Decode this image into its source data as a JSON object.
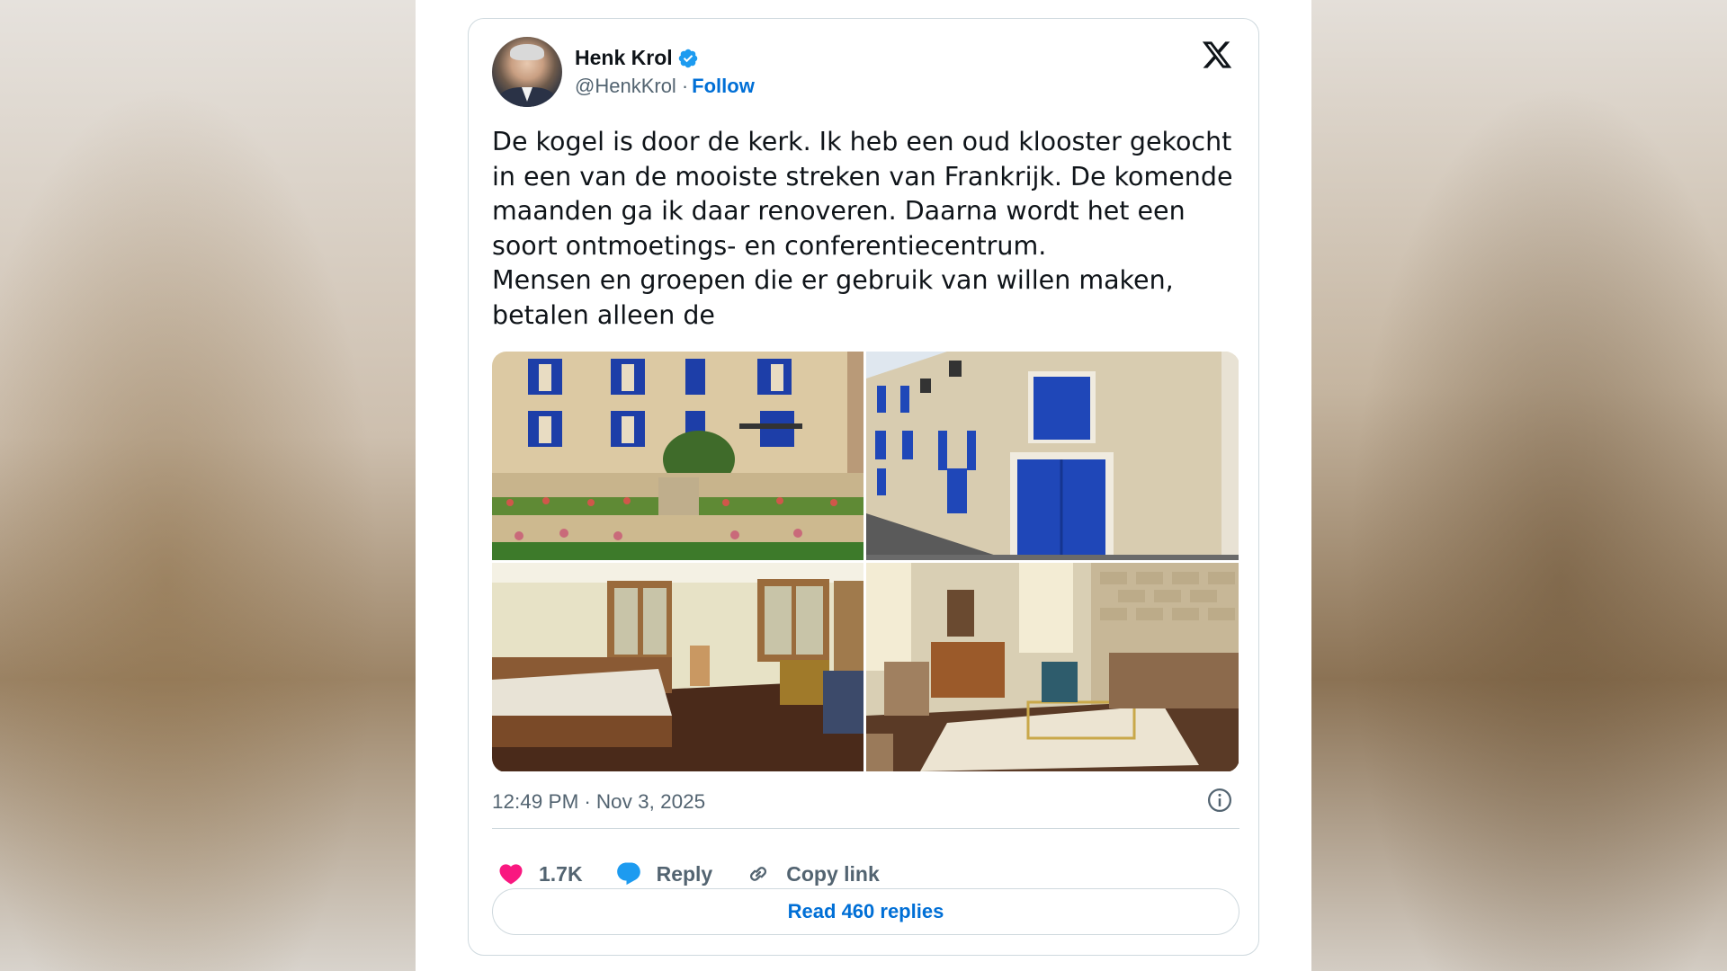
{
  "tweet": {
    "author_name": "Henk Krol",
    "handle": "@HenkKrol",
    "separator": "·",
    "follow_label": "Follow",
    "text": "De kogel is door de kerk. Ik heb een oud klooster gekocht in een van de mooiste streken van Frankrijk. De komende maanden ga ik daar renoveren. Daarna wordt het een soort ontmoetings- en conferentiecentrum.\nMensen en groepen die er gebruik van willen maken, betalen alleen de",
    "time": "12:49 PM",
    "date": "Nov 3, 2025",
    "likes": "1.7K",
    "reply_label": "Reply",
    "copy_link_label": "Copy link",
    "read_replies_label": "Read 460 replies"
  },
  "icons": {
    "verified": "verified-badge-icon",
    "logo": "x-logo-icon",
    "info": "info-icon",
    "like": "heart-icon",
    "reply": "speech-bubble-icon",
    "copy": "link-icon"
  },
  "colors": {
    "accent": "#006fd6",
    "verified": "#1d9bf0",
    "like": "#f91880",
    "text": "#0f1419",
    "muted": "#536471",
    "border": "#cfd9de"
  }
}
